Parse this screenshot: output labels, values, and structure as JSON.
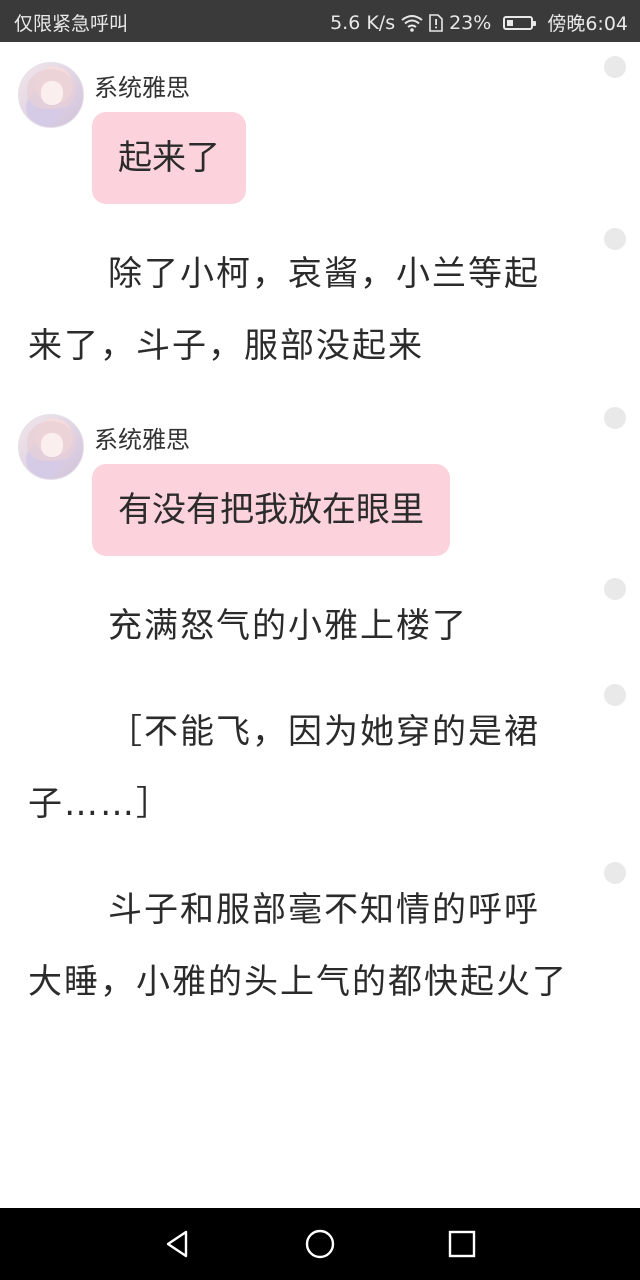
{
  "status_bar": {
    "carrier": "仅限紧急呼叫",
    "speed": "5.6 K/s",
    "battery": "23%",
    "time": "傍晚6:04"
  },
  "messages": [
    {
      "sender": "系统雅思",
      "text": "起来了"
    },
    {
      "sender": "系统雅思",
      "text": "有没有把我放在眼里"
    }
  ],
  "narration": [
    "除了小柯，哀酱，小兰等起来了，斗子，服部没起来",
    "充满怒气的小雅上楼了",
    "［不能飞，因为她穿的是裙子……］",
    "斗子和服部毫不知情的呼呼大睡，小雅的头上气的都快起火了"
  ],
  "nav": {
    "back": "back-icon",
    "home": "home-icon",
    "recents": "recents-icon"
  }
}
